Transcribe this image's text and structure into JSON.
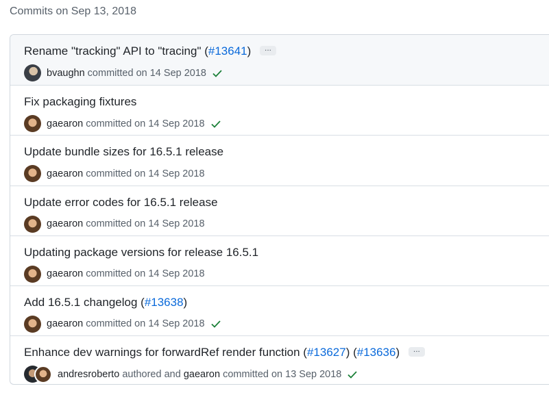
{
  "group": {
    "header": "Commits on Sep 13, 2018"
  },
  "commits": [
    {
      "title_parts": [
        "Rename \"tracking\" API to \"tracing\" (",
        "#13641",
        ")"
      ],
      "has_ellipsis": true,
      "ellipsis": "...",
      "author": "bvaughn",
      "author_label": "committed on 14 Sep 2018",
      "verified": true
    },
    {
      "title": "Fix packaging fixtures",
      "author": "gaearon",
      "author_label": "committed on 14 Sep 2018",
      "verified": true
    },
    {
      "title": "Update bundle sizes for 16.5.1 release",
      "author": "gaearon",
      "author_label": "committed on 14 Sep 2018",
      "verified": false
    },
    {
      "title": "Update error codes for 16.5.1 release",
      "author": "gaearon",
      "author_label": "committed on 14 Sep 2018",
      "verified": false
    },
    {
      "title": "Updating package versions for release 16.5.1",
      "author": "gaearon",
      "author_label": "committed on 14 Sep 2018",
      "verified": false
    },
    {
      "title_parts": [
        "Add 16.5.1 changelog (",
        "#13638",
        ")"
      ],
      "author": "gaearon",
      "author_label": "committed on 14 Sep 2018",
      "verified": true
    },
    {
      "title_parts": [
        "Enhance dev warnings for forwardRef render function (",
        "#13627",
        ") (",
        "#13636",
        ")"
      ],
      "has_ellipsis": true,
      "ellipsis": "...",
      "author": "andresroberto",
      "author_label": "authored and",
      "coauthor": "gaearon",
      "coauthor_label": "committed on 13 Sep 2018",
      "verified": true
    }
  ],
  "colors": {
    "link": "#0969da",
    "check": "#1a7f37",
    "muted": "#57606a"
  },
  "icons": {
    "verified": "check-icon",
    "more": "ellipsis-icon"
  }
}
